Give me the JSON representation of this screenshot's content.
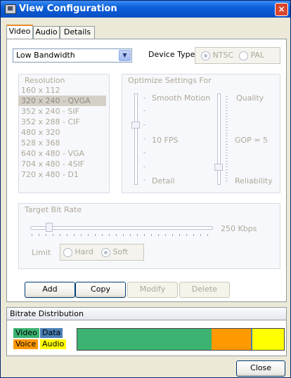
{
  "window": {
    "title": "View Configuration",
    "close_glyph": "×"
  },
  "tabs": [
    {
      "label": "Video",
      "active": true
    },
    {
      "label": "Audio"
    },
    {
      "label": "Details"
    }
  ],
  "profile": {
    "selected": "Low Bandwidth"
  },
  "device_type": {
    "label": "Device Type:",
    "options": [
      "NTSC",
      "PAL"
    ],
    "selected": "NTSC"
  },
  "resolution": {
    "title": "Resolution",
    "items": [
      "160 x 112",
      "320 x 240 - QVGA",
      "352 x 240 - SIF",
      "352 x 288 - CIF",
      "480 x 320",
      "528 x 368",
      "640 x 480 - VGA",
      "704 x 480 - 4SIF",
      "720 x 480 - D1"
    ],
    "selected_index": 1
  },
  "optimize": {
    "title": "Optimize Settings For",
    "left": {
      "top": "Smooth Motion",
      "middle": "10 FPS",
      "bottom": "Detail"
    },
    "right": {
      "top": "Quality",
      "middle": "GOP = 5",
      "bottom": "Reliability"
    }
  },
  "bitrate": {
    "title": "Target Bit Rate",
    "value": "250 Kbps",
    "limit_label": "Limit",
    "limit_options": [
      "Hard",
      "Soft"
    ],
    "limit_selected": "Soft"
  },
  "buttons": {
    "add": "Add",
    "copy": "Copy",
    "modify": "Modify",
    "delete": "Delete",
    "close": "Close"
  },
  "distribution": {
    "title": "Bitrate Distribution",
    "legend": [
      {
        "label": "Video",
        "color": "#3cb371"
      },
      {
        "label": "Data",
        "color": "#4a7fb5"
      },
      {
        "label": "Voice",
        "color": "#ff9900"
      },
      {
        "label": "Audio",
        "color": "#ffff00"
      }
    ],
    "segments": [
      {
        "name": "Video",
        "fraction": 0.65,
        "color": "#3cb371"
      },
      {
        "name": "Voice",
        "fraction": 0.19,
        "color": "#ff9900"
      },
      {
        "name": "Data",
        "fraction": 0.006,
        "color": "#4a7fb5"
      },
      {
        "name": "Audio",
        "fraction": 0.154,
        "color": "#ffff00"
      }
    ]
  },
  "colors": {
    "titlebar": "#0a5fd8",
    "accent_tab": "#e68b2c"
  }
}
